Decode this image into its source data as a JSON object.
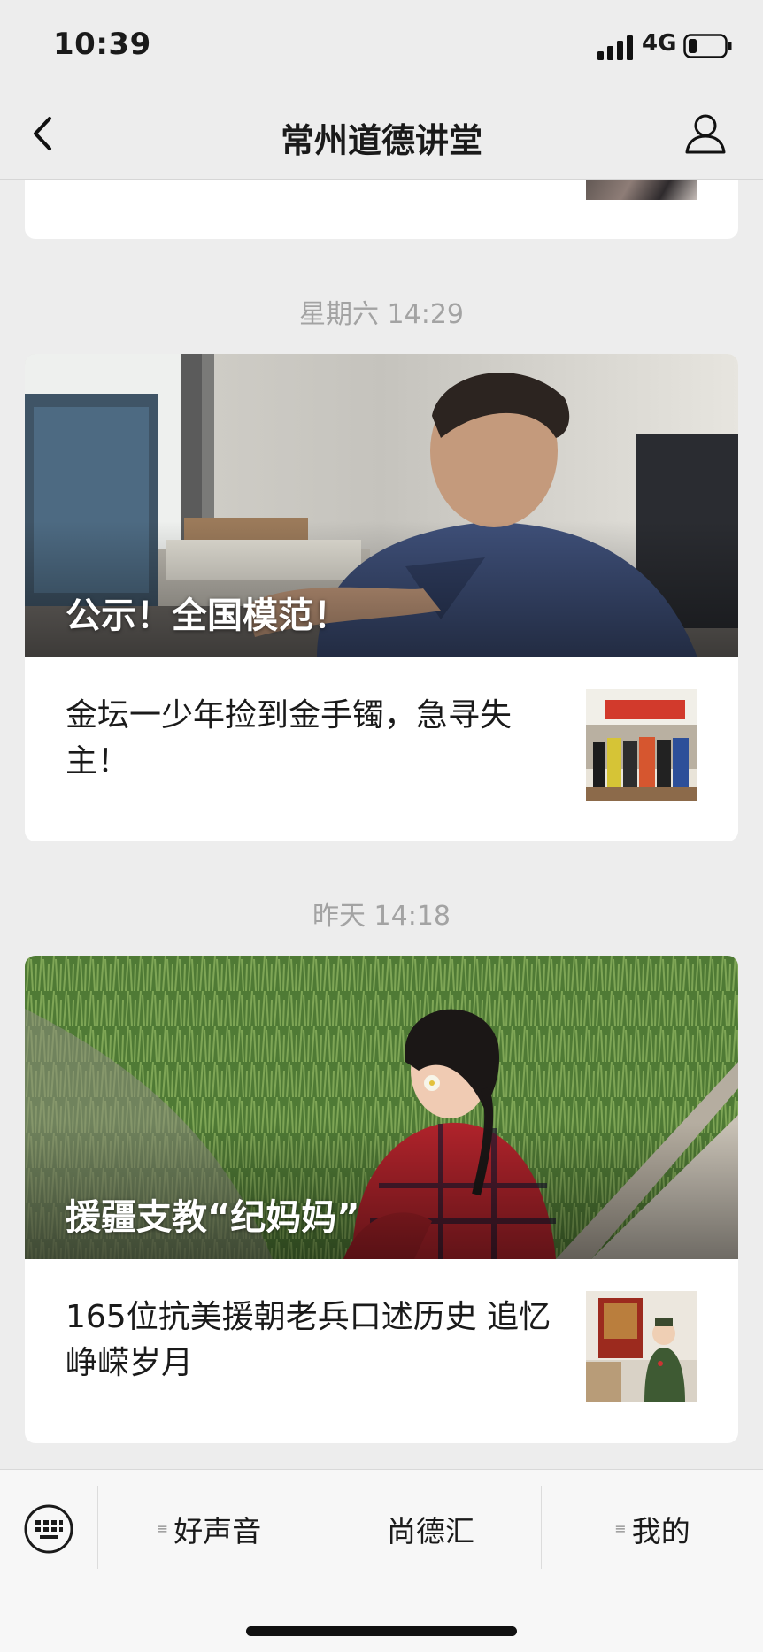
{
  "status_bar": {
    "time": "10:39",
    "network": "4G"
  },
  "nav": {
    "title": "常州道德讲堂"
  },
  "feed": {
    "groups": [
      {
        "timestamp": "星期六 14:29",
        "cover_title": "公示！全国模范！",
        "article": "金坛一少年捡到金手镯，急寻失主！"
      },
      {
        "timestamp": "昨天 14:18",
        "cover_title": "援疆支教“纪妈妈”",
        "article": "165位抗美援朝老兵口述历史 追忆峥嵘岁月"
      }
    ]
  },
  "menu": {
    "items": [
      {
        "label": "好声音",
        "has_submenu": true
      },
      {
        "label": "尚德汇",
        "has_submenu": false
      },
      {
        "label": "我的",
        "has_submenu": true
      }
    ]
  },
  "colors": {
    "background": "#ededed",
    "card": "#ffffff",
    "timestamp": "#a3a3a3"
  }
}
